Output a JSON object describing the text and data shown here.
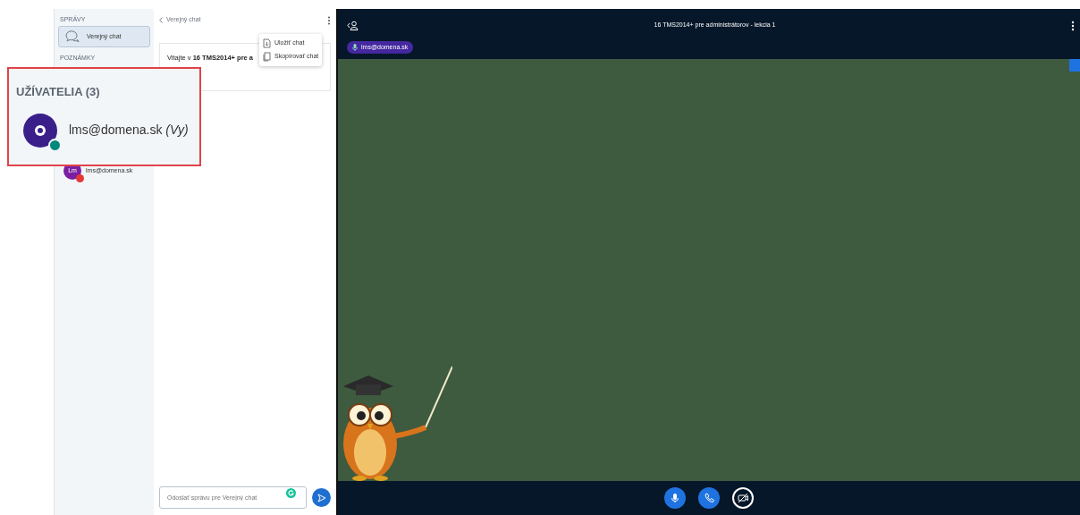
{
  "sidebar": {
    "sections": [
      {
        "title": "SPRÁVY",
        "items": [
          {
            "label": "Verejný chat",
            "selected": true
          }
        ]
      },
      {
        "title": "POZNÁMKY"
      }
    ],
    "users": [
      {
        "initials": "Lm",
        "name": "lms@domena.sk",
        "color": "#7b1fa2",
        "muted": true
      }
    ]
  },
  "callout": {
    "title": "UŽÍVATELIA (3)",
    "user": {
      "name": "lms@domena.sk",
      "you_label": "(Vy)",
      "muted": false
    }
  },
  "chat": {
    "back_label": "Verejný chat",
    "message": "Vitajte v **16 TMS2014+ pre a**",
    "menu": [
      {
        "label": "Uložiť chat",
        "kind": "save"
      },
      {
        "label": "Skopírovať chat",
        "kind": "copy"
      }
    ],
    "input": {
      "placeholder": "Odoslať správu pre Verejný chat"
    }
  },
  "meeting": {
    "title": "16 TMS2014+ pre administrátorov - lekcia 1",
    "talker": "lms@domena.sk",
    "controls": [
      {
        "kind": "mic",
        "active": true
      },
      {
        "kind": "phone",
        "active": true
      },
      {
        "kind": "camera",
        "active": false
      }
    ]
  }
}
